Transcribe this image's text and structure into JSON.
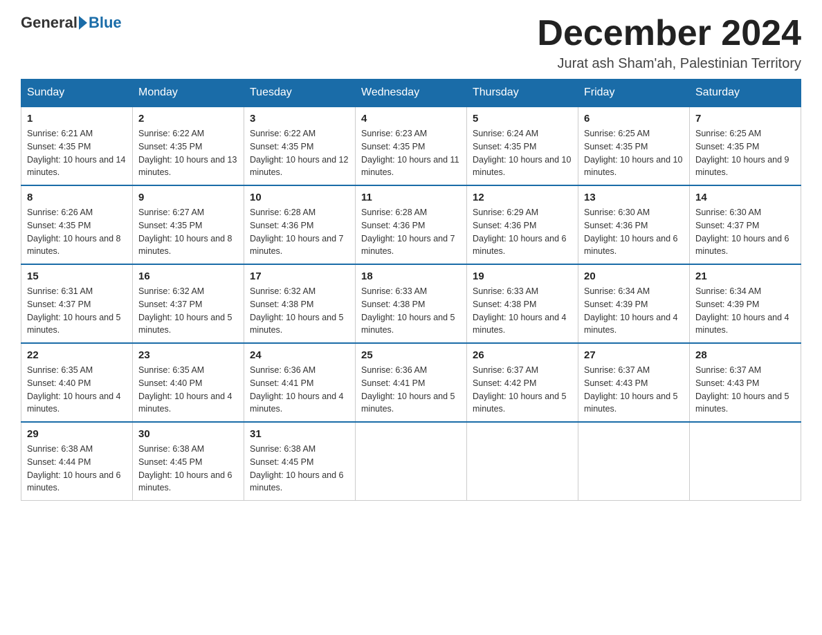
{
  "header": {
    "logo_general": "General",
    "logo_blue": "Blue",
    "month_title": "December 2024",
    "location": "Jurat ash Sham'ah, Palestinian Territory"
  },
  "weekdays": [
    "Sunday",
    "Monday",
    "Tuesday",
    "Wednesday",
    "Thursday",
    "Friday",
    "Saturday"
  ],
  "weeks": [
    [
      {
        "day": "1",
        "sunrise": "6:21 AM",
        "sunset": "4:35 PM",
        "daylight": "10 hours and 14 minutes."
      },
      {
        "day": "2",
        "sunrise": "6:22 AM",
        "sunset": "4:35 PM",
        "daylight": "10 hours and 13 minutes."
      },
      {
        "day": "3",
        "sunrise": "6:22 AM",
        "sunset": "4:35 PM",
        "daylight": "10 hours and 12 minutes."
      },
      {
        "day": "4",
        "sunrise": "6:23 AM",
        "sunset": "4:35 PM",
        "daylight": "10 hours and 11 minutes."
      },
      {
        "day": "5",
        "sunrise": "6:24 AM",
        "sunset": "4:35 PM",
        "daylight": "10 hours and 10 minutes."
      },
      {
        "day": "6",
        "sunrise": "6:25 AM",
        "sunset": "4:35 PM",
        "daylight": "10 hours and 10 minutes."
      },
      {
        "day": "7",
        "sunrise": "6:25 AM",
        "sunset": "4:35 PM",
        "daylight": "10 hours and 9 minutes."
      }
    ],
    [
      {
        "day": "8",
        "sunrise": "6:26 AM",
        "sunset": "4:35 PM",
        "daylight": "10 hours and 8 minutes."
      },
      {
        "day": "9",
        "sunrise": "6:27 AM",
        "sunset": "4:35 PM",
        "daylight": "10 hours and 8 minutes."
      },
      {
        "day": "10",
        "sunrise": "6:28 AM",
        "sunset": "4:36 PM",
        "daylight": "10 hours and 7 minutes."
      },
      {
        "day": "11",
        "sunrise": "6:28 AM",
        "sunset": "4:36 PM",
        "daylight": "10 hours and 7 minutes."
      },
      {
        "day": "12",
        "sunrise": "6:29 AM",
        "sunset": "4:36 PM",
        "daylight": "10 hours and 6 minutes."
      },
      {
        "day": "13",
        "sunrise": "6:30 AM",
        "sunset": "4:36 PM",
        "daylight": "10 hours and 6 minutes."
      },
      {
        "day": "14",
        "sunrise": "6:30 AM",
        "sunset": "4:37 PM",
        "daylight": "10 hours and 6 minutes."
      }
    ],
    [
      {
        "day": "15",
        "sunrise": "6:31 AM",
        "sunset": "4:37 PM",
        "daylight": "10 hours and 5 minutes."
      },
      {
        "day": "16",
        "sunrise": "6:32 AM",
        "sunset": "4:37 PM",
        "daylight": "10 hours and 5 minutes."
      },
      {
        "day": "17",
        "sunrise": "6:32 AM",
        "sunset": "4:38 PM",
        "daylight": "10 hours and 5 minutes."
      },
      {
        "day": "18",
        "sunrise": "6:33 AM",
        "sunset": "4:38 PM",
        "daylight": "10 hours and 5 minutes."
      },
      {
        "day": "19",
        "sunrise": "6:33 AM",
        "sunset": "4:38 PM",
        "daylight": "10 hours and 4 minutes."
      },
      {
        "day": "20",
        "sunrise": "6:34 AM",
        "sunset": "4:39 PM",
        "daylight": "10 hours and 4 minutes."
      },
      {
        "day": "21",
        "sunrise": "6:34 AM",
        "sunset": "4:39 PM",
        "daylight": "10 hours and 4 minutes."
      }
    ],
    [
      {
        "day": "22",
        "sunrise": "6:35 AM",
        "sunset": "4:40 PM",
        "daylight": "10 hours and 4 minutes."
      },
      {
        "day": "23",
        "sunrise": "6:35 AM",
        "sunset": "4:40 PM",
        "daylight": "10 hours and 4 minutes."
      },
      {
        "day": "24",
        "sunrise": "6:36 AM",
        "sunset": "4:41 PM",
        "daylight": "10 hours and 4 minutes."
      },
      {
        "day": "25",
        "sunrise": "6:36 AM",
        "sunset": "4:41 PM",
        "daylight": "10 hours and 5 minutes."
      },
      {
        "day": "26",
        "sunrise": "6:37 AM",
        "sunset": "4:42 PM",
        "daylight": "10 hours and 5 minutes."
      },
      {
        "day": "27",
        "sunrise": "6:37 AM",
        "sunset": "4:43 PM",
        "daylight": "10 hours and 5 minutes."
      },
      {
        "day": "28",
        "sunrise": "6:37 AM",
        "sunset": "4:43 PM",
        "daylight": "10 hours and 5 minutes."
      }
    ],
    [
      {
        "day": "29",
        "sunrise": "6:38 AM",
        "sunset": "4:44 PM",
        "daylight": "10 hours and 6 minutes."
      },
      {
        "day": "30",
        "sunrise": "6:38 AM",
        "sunset": "4:45 PM",
        "daylight": "10 hours and 6 minutes."
      },
      {
        "day": "31",
        "sunrise": "6:38 AM",
        "sunset": "4:45 PM",
        "daylight": "10 hours and 6 minutes."
      },
      null,
      null,
      null,
      null
    ]
  ],
  "labels": {
    "sunrise_prefix": "Sunrise: ",
    "sunset_prefix": "Sunset: ",
    "daylight_prefix": "Daylight: "
  }
}
